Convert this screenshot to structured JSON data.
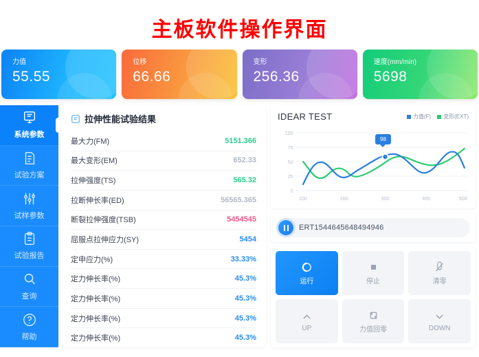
{
  "page": {
    "title": "主板软件操作界面",
    "title_color": "#fe0000"
  },
  "kpis": [
    {
      "label": "力值",
      "value": "55.55",
      "color": "#12a0fb",
      "icon": "gauge-icon"
    },
    {
      "label": "位移",
      "value": "66.66",
      "color": "#f9883c",
      "icon": "gauge-icon"
    },
    {
      "label": "变形",
      "value": "256.36",
      "color": "#9279d0",
      "icon": "gauge-icon"
    },
    {
      "label": "速度(mm/min)",
      "value": "5698",
      "color": "#2ad378",
      "icon": "gauge-icon"
    }
  ],
  "sidebar": {
    "items": [
      {
        "label": "系统参数",
        "icon": "monitor-doc-icon",
        "active": true
      },
      {
        "label": "试验方案",
        "icon": "document-icon",
        "active": false
      },
      {
        "label": "试样参数",
        "icon": "sliders-icon",
        "active": false
      },
      {
        "label": "试验报告",
        "icon": "clipboard-icon",
        "active": false
      },
      {
        "label": "查询",
        "icon": "search-icon",
        "active": false
      },
      {
        "label": "帮助",
        "icon": "question-circle-icon",
        "active": false
      }
    ]
  },
  "results_panel": {
    "title": "拉伸性能试验结果",
    "icon": "report-icon",
    "rows": [
      {
        "label": "最大力(FM)",
        "value": "5151.366",
        "color": "#2ecc8f"
      },
      {
        "label": "最大变形(EM)",
        "value": "652.33",
        "color": "#b3b9c4"
      },
      {
        "label": "拉伸强度(TS)",
        "value": "565.32",
        "color": "#2ecc8f"
      },
      {
        "label": "拉断伸长率(ED)",
        "value": "56565.365",
        "color": "#b3b9c4"
      },
      {
        "label": "断裂拉伸强度(TSB)",
        "value": "5454545",
        "color": "#f2568a"
      },
      {
        "label": "屈服点拉伸应力(SY)",
        "value": "5454",
        "color": "#2b8cf0"
      },
      {
        "label": "定申应力(%)",
        "value": "33.33%",
        "color": "#2b8cf0"
      },
      {
        "label": "定力伸长率(%)",
        "value": "45.3%",
        "color": "#2b8cf0"
      },
      {
        "label": "定力伸长率(%)",
        "value": "45.3%",
        "color": "#2b8cf0"
      },
      {
        "label": "定力伸长率(%)",
        "value": "45.3%",
        "color": "#2b8cf0"
      },
      {
        "label": "定力伸长率(%)",
        "value": "45.3%",
        "color": "#2b8cf0"
      }
    ]
  },
  "chart_data": {
    "type": "line",
    "title": "IDEAR TEST",
    "xlabel": "",
    "ylabel": "",
    "grid": true,
    "legend_position": "top-right",
    "xlim": [
      100,
      500
    ],
    "ylim": [
      0,
      100
    ],
    "xticks": [
      "100",
      "200",
      "300",
      "400",
      "500"
    ],
    "yticks": [
      "0",
      "25",
      "50",
      "75",
      "100"
    ],
    "annotation": {
      "label": "98",
      "x": 315,
      "y": 63
    },
    "series": [
      {
        "name": "力值(F)",
        "color": "#2b7fe0",
        "x": [
          100,
          140,
          160,
          190,
          215,
          245,
          280,
          315,
          350,
          385,
          415,
          445,
          475,
          500
        ],
        "values": [
          11,
          44,
          53,
          38,
          26,
          31,
          48,
          63,
          60,
          36,
          46,
          74,
          62,
          39
        ]
      },
      {
        "name": "变形(EXT)",
        "color": "#2ecc71",
        "x": [
          100,
          140,
          160,
          190,
          215,
          245,
          280,
          315,
          350,
          385,
          415,
          445,
          475,
          500
        ],
        "values": [
          50,
          28,
          22,
          26,
          39,
          27,
          28,
          42,
          58,
          56,
          45,
          40,
          48,
          65
        ]
      }
    ]
  },
  "serial": {
    "text": "ERT1544645648494946",
    "pause_icon": "pause-icon"
  },
  "controls": {
    "rows": [
      [
        {
          "label": "运行",
          "icon": "run-icon",
          "primary": true
        },
        {
          "label": "停止",
          "icon": "stop-icon",
          "primary": false
        },
        {
          "label": "清零",
          "icon": "clear-icon",
          "primary": false
        }
      ],
      [
        {
          "label": "UP",
          "icon": "chevron-up-icon",
          "primary": false
        },
        {
          "label": "力值回零",
          "icon": "reset-loop-icon",
          "primary": false
        },
        {
          "label": "DOWN",
          "icon": "chevron-down-icon",
          "primary": false
        }
      ]
    ]
  }
}
